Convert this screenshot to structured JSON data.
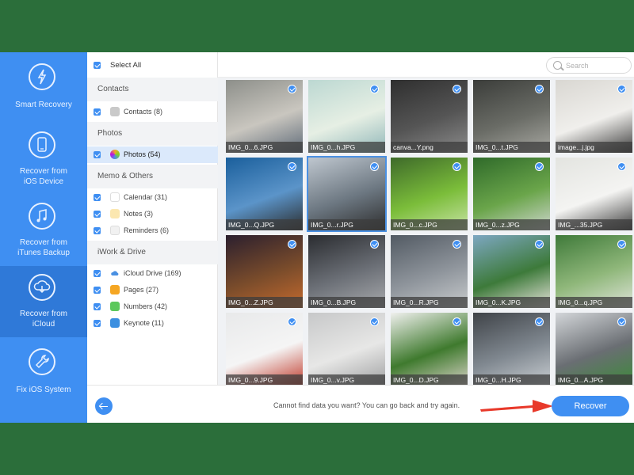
{
  "nav": {
    "items": [
      {
        "label": "Smart Recovery",
        "icon": "bolt-icon"
      },
      {
        "label": "Recover from\niOS Device",
        "icon": "phone-icon"
      },
      {
        "label": "Recover from\niTunes Backup",
        "icon": "music-note-icon"
      },
      {
        "label": "Recover from\niCloud",
        "icon": "cloud-download-icon",
        "active": true
      },
      {
        "label": "Fix iOS System",
        "icon": "wrench-icon"
      }
    ]
  },
  "categories": {
    "select_all": "Select All",
    "groups": [
      {
        "title": "Contacts",
        "items": [
          {
            "label": "Contacts (8)",
            "icon": "contacts-icon"
          }
        ]
      },
      {
        "title": "Photos",
        "items": [
          {
            "label": "Photos (54)",
            "icon": "photos-icon",
            "active": true
          }
        ]
      },
      {
        "title": "Memo & Others",
        "items": [
          {
            "label": "Calendar (31)",
            "icon": "calendar-icon"
          },
          {
            "label": "Notes (3)",
            "icon": "notes-icon"
          },
          {
            "label": "Reminders (6)",
            "icon": "reminders-icon"
          }
        ]
      },
      {
        "title": "iWork & Drive",
        "items": [
          {
            "label": "iCloud Drive (169)",
            "icon": "icloud-drive-icon"
          },
          {
            "label": "Pages (27)",
            "icon": "pages-icon"
          },
          {
            "label": "Numbers (42)",
            "icon": "numbers-icon"
          },
          {
            "label": "Keynote (11)",
            "icon": "keynote-icon"
          }
        ]
      }
    ]
  },
  "search": {
    "placeholder": "Search"
  },
  "photos": [
    "IMG_0...6.JPG",
    "IMG_0...h.JPG",
    "canva...Y.png",
    "IMG_0...t.JPG",
    "image...j.jpg",
    "IMG_0...Q.JPG",
    "IMG_0...r.JPG",
    "IMG_0...c.JPG",
    "IMG_0...z.JPG",
    "IMG_...35.JPG",
    "IMG_0...Z.JPG",
    "IMG_0...B.JPG",
    "IMG_0...R.JPG",
    "IMG_0...K.JPG",
    "IMG_0...q.JPG",
    "IMG_0...9.JPG",
    "IMG_0...v.JPG",
    "IMG_0...D.JPG",
    "IMG_0...H.JPG",
    "IMG_0...A.JPG"
  ],
  "bottom": {
    "hint": "Cannot find data you want? You can go back and try again.",
    "recover_label": "Recover"
  },
  "colors": {
    "accent": "#3f8ff2",
    "nav_active": "#2f79d8",
    "arrow": "#e8392a",
    "background": "#2b6e3a"
  }
}
